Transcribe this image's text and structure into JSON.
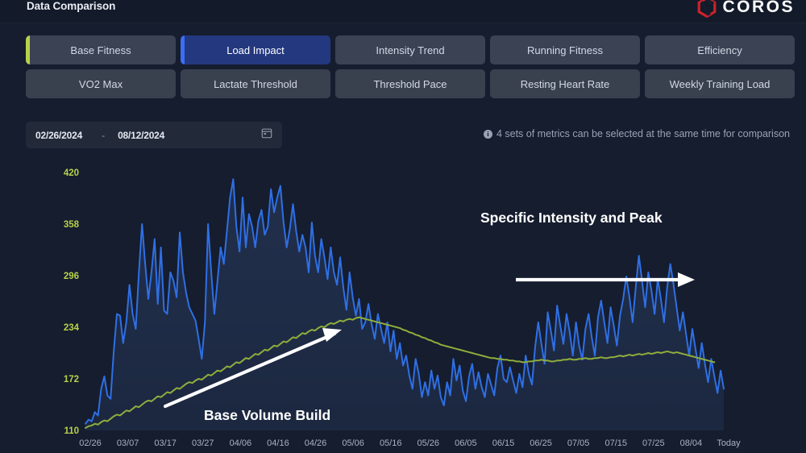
{
  "header": {
    "title": "Data Comparison",
    "brand": "COROS",
    "brand_color": "#c8232c"
  },
  "metrics": {
    "row1": [
      {
        "label": "Base Fitness",
        "accent": "#b9d14a",
        "selected": false
      },
      {
        "label": "Load Impact",
        "accent": "#3b6ef5",
        "selected": true
      },
      {
        "label": "Intensity Trend",
        "accent": "",
        "selected": false
      },
      {
        "label": "Running Fitness",
        "accent": "",
        "selected": false
      },
      {
        "label": "Efficiency",
        "accent": "",
        "selected": false
      }
    ],
    "row2": [
      {
        "label": "VO2 Max",
        "accent": "",
        "selected": false
      },
      {
        "label": "Lactate Threshold",
        "accent": "",
        "selected": false
      },
      {
        "label": "Threshold Pace",
        "accent": "",
        "selected": false
      },
      {
        "label": "Resting Heart Rate",
        "accent": "",
        "selected": false
      },
      {
        "label": "Weekly Training Load",
        "accent": "",
        "selected": false
      }
    ]
  },
  "date_range": {
    "start": "02/26/2024",
    "separator": "-",
    "end": "08/12/2024",
    "icon": "calendar-icon"
  },
  "hint": {
    "icon": "info-icon",
    "text": "4 sets of metrics can be selected at the same time for comparison"
  },
  "annotations": [
    {
      "label": "Base Volume Build"
    },
    {
      "label": "Specific Intensity and Peak"
    }
  ],
  "chart_data": {
    "type": "line",
    "title": "",
    "xlabel": "",
    "ylabel": "",
    "ylim": [
      110,
      420
    ],
    "grid": false,
    "legend": "none",
    "y_ticks": [
      420,
      358,
      296,
      234,
      172,
      110
    ],
    "x_ticks": [
      "02/26",
      "03/07",
      "03/17",
      "03/27",
      "04/06",
      "04/16",
      "04/26",
      "05/06",
      "05/16",
      "05/26",
      "06/05",
      "06/15",
      "06/25",
      "07/05",
      "07/15",
      "07/25",
      "08/04",
      "Today"
    ],
    "series": [
      {
        "name": "Load Impact",
        "color": "#2f6fe4",
        "area_fill": "#20304f",
        "values": [
          118,
          123,
          121,
          132,
          128,
          160,
          175,
          152,
          148,
          205,
          250,
          248,
          215,
          240,
          285,
          250,
          232,
          300,
          358,
          310,
          268,
          300,
          340,
          262,
          330,
          254,
          250,
          300,
          290,
          270,
          348,
          300,
          276,
          258,
          250,
          242,
          220,
          196,
          240,
          358,
          300,
          250,
          290,
          330,
          310,
          350,
          390,
          412,
          355,
          325,
          390,
          330,
          370,
          355,
          330,
          362,
          375,
          345,
          355,
          400,
          372,
          390,
          404,
          360,
          330,
          352,
          382,
          350,
          325,
          345,
          330,
          300,
          360,
          320,
          300,
          340,
          318,
          292,
          330,
          300,
          285,
          318,
          282,
          255,
          300,
          270,
          248,
          268,
          232,
          240,
          262,
          238,
          220,
          250,
          232,
          215,
          240,
          205,
          230,
          196,
          215,
          188,
          200,
          176,
          160,
          196,
          178,
          150,
          168,
          152,
          182,
          160,
          176,
          150,
          140,
          168,
          152,
          196,
          170,
          188,
          158,
          145,
          175,
          190,
          160,
          180,
          162,
          150,
          178,
          165,
          152,
          185,
          200,
          172,
          168,
          186,
          170,
          155,
          178,
          162,
          200,
          178,
          165,
          210,
          240,
          214,
          190,
          252,
          230,
          206,
          260,
          236,
          214,
          250,
          228,
          200,
          240,
          212,
          195,
          232,
          250,
          222,
          200,
          246,
          266,
          240,
          215,
          258,
          236,
          212,
          248,
          268,
          295,
          270,
          240,
          282,
          320,
          290,
          258,
          300,
          278,
          250,
          292,
          268,
          240,
          282,
          310,
          286,
          258,
          230,
          252,
          226,
          200,
          232,
          208,
          185,
          215,
          190,
          168,
          196,
          175,
          155,
          182,
          160
        ]
      },
      {
        "name": "Base Fitness",
        "color": "#8fad3c",
        "values": [
          113,
          115,
          116,
          118,
          117,
          120,
          122,
          121,
          124,
          127,
          129,
          128,
          131,
          134,
          133,
          136,
          139,
          138,
          141,
          144,
          146,
          145,
          148,
          151,
          150,
          153,
          156,
          155,
          158,
          161,
          160,
          163,
          166,
          168,
          167,
          170,
          172,
          171,
          174,
          177,
          176,
          179,
          182,
          181,
          184,
          187,
          186,
          189,
          192,
          191,
          194,
          197,
          196,
          199,
          202,
          201,
          204,
          207,
          206,
          209,
          212,
          211,
          214,
          217,
          216,
          219,
          222,
          221,
          224,
          227,
          226,
          229,
          231,
          230,
          233,
          235,
          234,
          237,
          239,
          238,
          240,
          242,
          241,
          243,
          244,
          243,
          245,
          246,
          245,
          244,
          243,
          242,
          241,
          240,
          239,
          238,
          237,
          236,
          235,
          234,
          233,
          231,
          230,
          228,
          227,
          225,
          224,
          222,
          221,
          219,
          218,
          216,
          215,
          213,
          212,
          211,
          210,
          209,
          208,
          207,
          206,
          205,
          204,
          203,
          202,
          201,
          200,
          199,
          198,
          197,
          197,
          196,
          196,
          195,
          195,
          194,
          194,
          193,
          193,
          192,
          192,
          193,
          193,
          194,
          194,
          195,
          194,
          194,
          193,
          193,
          194,
          194,
          195,
          195,
          196,
          195,
          195,
          196,
          196,
          197,
          196,
          196,
          197,
          197,
          198,
          197,
          197,
          198,
          198,
          199,
          200,
          199,
          200,
          201,
          200,
          201,
          202,
          201,
          202,
          203,
          202,
          203,
          204,
          203,
          204,
          205,
          204,
          203,
          204,
          203,
          202,
          201,
          200,
          199,
          198,
          197,
          196,
          195,
          194,
          193,
          192
        ]
      }
    ]
  }
}
